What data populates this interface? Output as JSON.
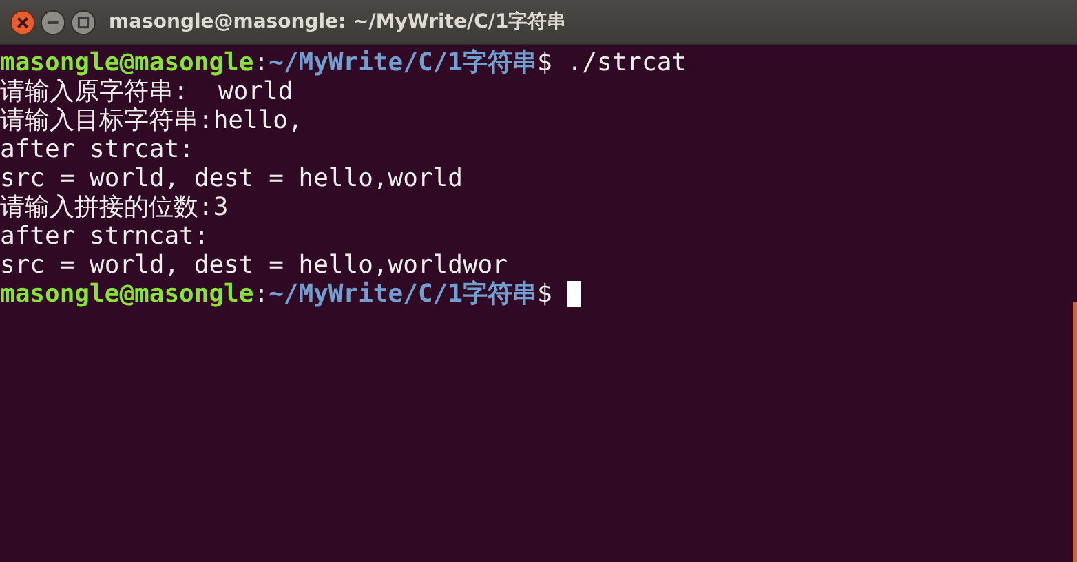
{
  "window": {
    "title": "masongle@masongle: ~/MyWrite/C/1字符串"
  },
  "terminal": {
    "lines": [
      {
        "kind": "prompt",
        "user": "masongle@masongle",
        "separator": ":",
        "path": "~/MyWrite/C/1字符串",
        "symbol": "$",
        "command": "./strcat",
        "cursor": false
      },
      {
        "kind": "output",
        "text": "请输入原字符串:  world"
      },
      {
        "kind": "output",
        "text": "请输入目标字符串:hello,"
      },
      {
        "kind": "output",
        "text": "after strcat:"
      },
      {
        "kind": "output",
        "text": "src = world, dest = hello,world"
      },
      {
        "kind": "output",
        "text": "请输入拼接的位数:3"
      },
      {
        "kind": "output",
        "text": "after strncat:"
      },
      {
        "kind": "output",
        "text": "src = world, dest = hello,worldwor"
      },
      {
        "kind": "prompt",
        "user": "masongle@masongle",
        "separator": ":",
        "path": "~/MyWrite/C/1字符串",
        "symbol": "$",
        "cursor": true
      }
    ]
  }
}
